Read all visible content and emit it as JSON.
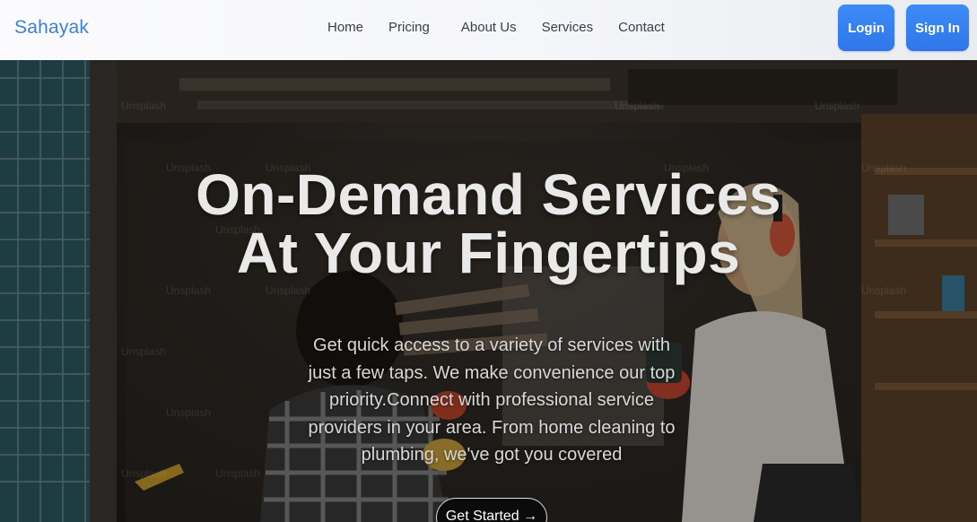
{
  "navbar": {
    "brand": "Sahayak",
    "links": [
      "Home",
      "Pricing",
      "About Us",
      "Services",
      "Contact"
    ],
    "login_label": "Login",
    "signin_label": "Sign In"
  },
  "hero": {
    "headline_line1": "On-Demand Services",
    "headline_line2": "At Your Fingertips",
    "description": "Get quick access to a variety of services with just a few taps. We make convenience our top priority.Connect with professional service providers in your area. From home cleaning to plumbing, we've got you covered",
    "cta_label": "Get Started →",
    "watermark_text": "Unsplash"
  },
  "colors": {
    "brand": "#3f7fd7",
    "button_primary": "#3483f0",
    "cta_background": "#0b0b0b"
  }
}
